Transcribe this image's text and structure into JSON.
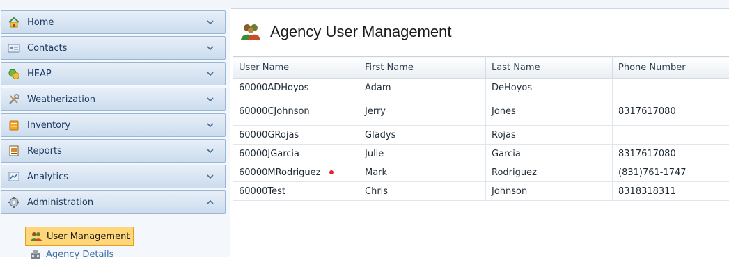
{
  "sidebar": {
    "items": [
      {
        "label": "Home",
        "icon": "home-icon",
        "expanded": false
      },
      {
        "label": "Contacts",
        "icon": "contacts-card-icon",
        "expanded": false
      },
      {
        "label": "HEAP",
        "icon": "money-icon",
        "expanded": false
      },
      {
        "label": "Weatherization",
        "icon": "tools-icon",
        "expanded": false
      },
      {
        "label": "Inventory",
        "icon": "inventory-icon",
        "expanded": false
      },
      {
        "label": "Reports",
        "icon": "reports-icon",
        "expanded": false
      },
      {
        "label": "Analytics",
        "icon": "analytics-icon",
        "expanded": false
      },
      {
        "label": "Administration",
        "icon": "gear-icon",
        "expanded": true
      }
    ],
    "subitems": [
      {
        "label": "User Management",
        "icon": "users-icon",
        "active": true
      },
      {
        "label": "Agency Details",
        "icon": "agency-icon",
        "active": false
      }
    ]
  },
  "main": {
    "title": "Agency User Management",
    "table": {
      "columns": [
        "User Name",
        "First Name",
        "Last Name",
        "Phone Number"
      ],
      "rows": [
        [
          "60000ADHoyos",
          "Adam",
          "DeHoyos",
          ""
        ],
        [
          "60000CJohnson",
          "Jerry",
          "Jones",
          "8317617080"
        ],
        [
          "60000GRojas",
          "Gladys",
          "Rojas",
          ""
        ],
        [
          "60000JGarcia",
          "Julie",
          "Garcia",
          "8317617080"
        ],
        [
          "60000MRodriguez",
          "Mark",
          "Rodriguez",
          "(831)761-1747"
        ],
        [
          "60000Test",
          "Chris",
          "Johnson",
          "8318318311"
        ]
      ]
    }
  },
  "colors": {
    "accent": "#ffd77a",
    "nav_border": "#9ab7d6",
    "status_dot": "#e0242c"
  }
}
